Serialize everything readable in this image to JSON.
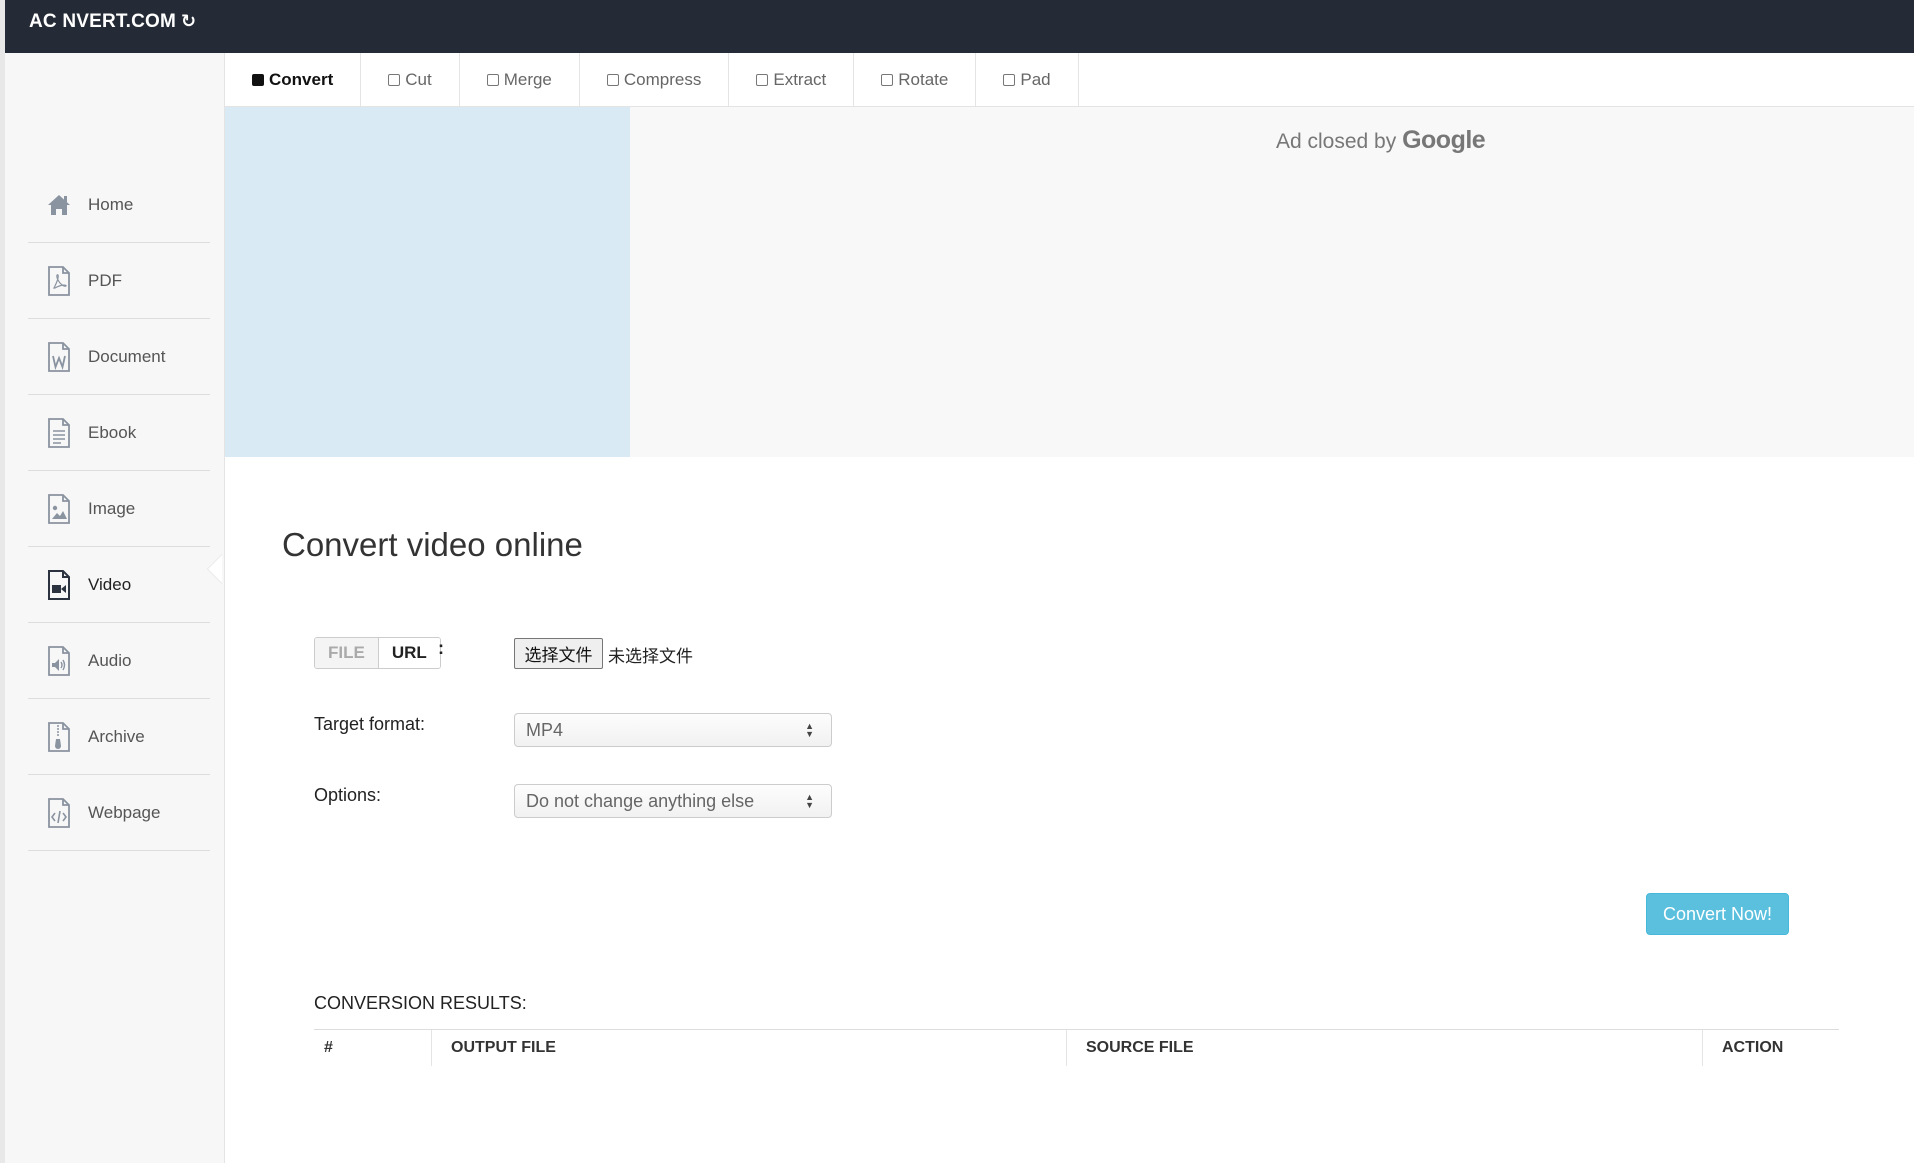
{
  "header": {
    "brand": "AC NVERT.COM",
    "brand_icon": "refresh-icon",
    "bg_color": "#252b36"
  },
  "sidebar": {
    "items": [
      {
        "label": "Home",
        "icon": "home-icon"
      },
      {
        "label": "PDF",
        "icon": "pdf-file-icon"
      },
      {
        "label": "Document",
        "icon": "word-file-icon"
      },
      {
        "label": "Ebook",
        "icon": "text-file-icon"
      },
      {
        "label": "Image",
        "icon": "image-file-icon"
      },
      {
        "label": "Video",
        "icon": "video-file-icon",
        "active": true
      },
      {
        "label": "Audio",
        "icon": "audio-file-icon"
      },
      {
        "label": "Archive",
        "icon": "archive-file-icon"
      },
      {
        "label": "Webpage",
        "icon": "code-file-icon"
      }
    ]
  },
  "tabs": [
    {
      "label": "Convert",
      "active": true
    },
    {
      "label": "Cut"
    },
    {
      "label": "Merge"
    },
    {
      "label": "Compress"
    },
    {
      "label": "Extract"
    },
    {
      "label": "Rotate"
    },
    {
      "label": "Pad"
    }
  ],
  "ad": {
    "text": "Ad closed by",
    "brand": "Google"
  },
  "main": {
    "title": "Convert video online",
    "source_toggle": {
      "file": "FILE",
      "url": "URL",
      "colon": ":"
    },
    "file_input": {
      "button": "选择文件",
      "status": "未选择文件"
    },
    "target_format": {
      "label": "Target format:",
      "value": "MP4"
    },
    "options": {
      "label": "Options:",
      "value": "Do not change anything else"
    },
    "convert_button": "Convert Now!",
    "accent_color": "#5bc0de"
  },
  "results": {
    "title": "CONVERSION RESULTS:",
    "columns": [
      "#",
      "OUTPUT FILE",
      "SOURCE FILE",
      "ACTION"
    ]
  }
}
